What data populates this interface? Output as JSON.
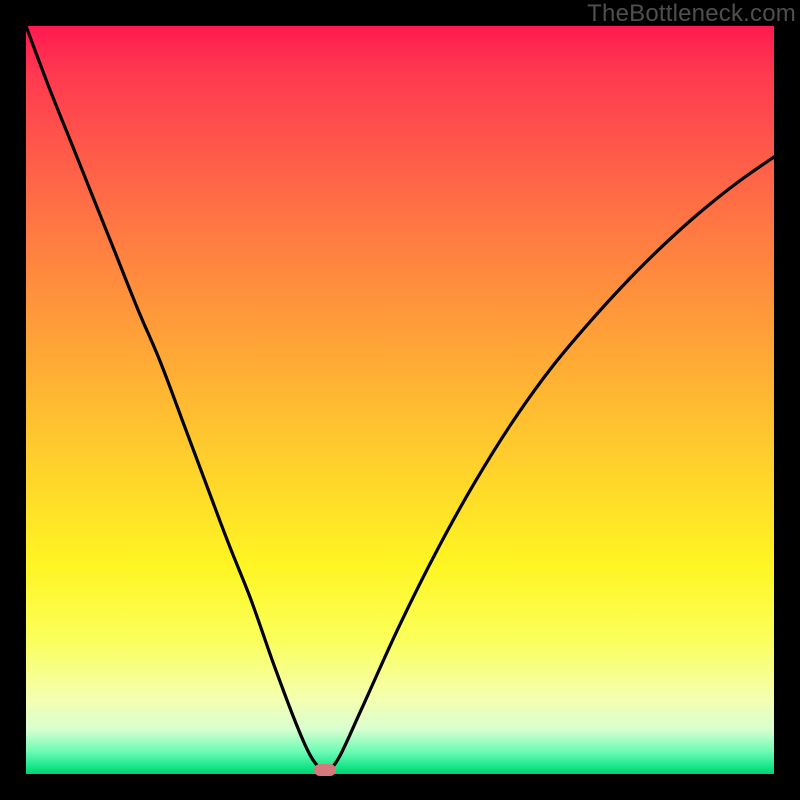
{
  "watermark": "TheBottleneck.com",
  "colors": {
    "curve_stroke": "#000000",
    "marker_fill": "#d47a7d",
    "frame_bg": "#000000"
  },
  "chart_data": {
    "type": "line",
    "title": "",
    "xlabel": "",
    "ylabel": "",
    "xlim": [
      0,
      100
    ],
    "ylim": [
      0,
      100
    ],
    "x": [
      0,
      3,
      6,
      9,
      12,
      15,
      18,
      21,
      24,
      27,
      30,
      33,
      36,
      38,
      39.5,
      40.5,
      42,
      45,
      50,
      55,
      60,
      65,
      70,
      75,
      80,
      85,
      90,
      95,
      100
    ],
    "values": [
      100,
      92,
      84.5,
      77,
      69.5,
      62,
      55,
      47,
      39,
      31,
      23.5,
      15,
      7,
      2.5,
      0.6,
      0.6,
      2.5,
      9,
      20,
      30,
      39,
      47,
      54,
      60,
      65.5,
      70.5,
      75,
      79,
      82.5
    ],
    "marker": {
      "x": 40,
      "y": 0.6
    },
    "notes": "V-shaped bottleneck curve over rainbow gradient; minimum near x≈40. Values are percentages estimated from pixel positions (no visible axes or ticks)."
  }
}
